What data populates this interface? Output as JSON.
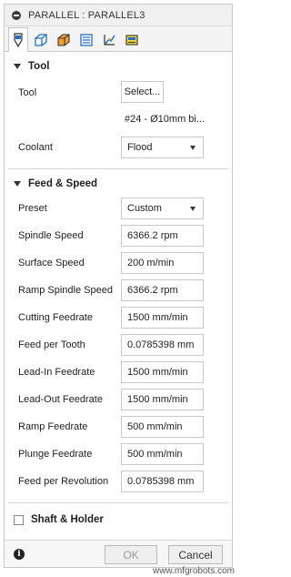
{
  "window": {
    "title": "PARALLEL : PARALLEL3"
  },
  "tabs": [
    {
      "icon": "tool-icon",
      "active": true
    },
    {
      "icon": "geometry-icon",
      "active": false
    },
    {
      "icon": "heights-icon",
      "active": false
    },
    {
      "icon": "passes-icon",
      "active": false
    },
    {
      "icon": "linking-icon",
      "active": false
    },
    {
      "icon": "setup-icon",
      "active": false
    }
  ],
  "tool_section": {
    "title": "Tool",
    "tool_label": "Tool",
    "select_label": "Select...",
    "tool_description": "#24 - Ø10mm bi...",
    "coolant_label": "Coolant",
    "coolant_value": "Flood"
  },
  "feed_section": {
    "title": "Feed & Speed",
    "preset_label": "Preset",
    "preset_value": "Custom",
    "rows": [
      {
        "label": "Spindle Speed",
        "value": "6366.2 rpm"
      },
      {
        "label": "Surface Speed",
        "value": "200 m/min"
      },
      {
        "label": "Ramp Spindle Speed",
        "value": "6366.2 rpm"
      },
      {
        "label": "Cutting Feedrate",
        "value": "1500 mm/min"
      },
      {
        "label": "Feed per Tooth",
        "value": "0.0785398 mm"
      },
      {
        "label": "Lead-In Feedrate",
        "value": "1500 mm/min"
      },
      {
        "label": "Lead-Out Feedrate",
        "value": "1500 mm/min"
      },
      {
        "label": "Ramp Feedrate",
        "value": "500 mm/min"
      },
      {
        "label": "Plunge Feedrate",
        "value": "500 mm/min"
      },
      {
        "label": "Feed per Revolution",
        "value": "0.0785398 mm"
      }
    ]
  },
  "shaft_section": {
    "title": "Shaft & Holder"
  },
  "footer": {
    "ok_label": "OK",
    "cancel_label": "Cancel"
  },
  "watermark": "www.mfgrobots.com",
  "colors": {
    "accent_blue": "#1f6fc2",
    "accent_orange": "#f0a030",
    "accent_yellow": "#f2d23a"
  }
}
